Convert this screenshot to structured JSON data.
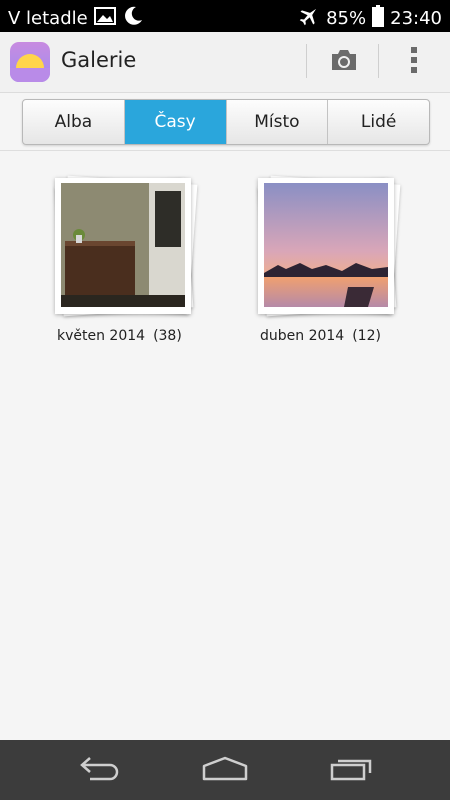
{
  "status_bar": {
    "carrier_text": "V letadle",
    "battery": "85%",
    "time": "23:40",
    "icons": [
      "image-icon",
      "moon-icon",
      "airplane-icon",
      "battery-icon"
    ]
  },
  "app": {
    "title": "Galerie",
    "icon": "gallery-app-icon",
    "actions": [
      "camera-icon",
      "overflow-menu-icon"
    ]
  },
  "tabs": [
    {
      "label": "Alba",
      "active": false
    },
    {
      "label": "Časy",
      "active": true
    },
    {
      "label": "Místo",
      "active": false
    },
    {
      "label": "Lidé",
      "active": false
    }
  ],
  "albums": [
    {
      "name": "květen 2014",
      "count": "(38)"
    },
    {
      "name": "duben 2014",
      "count": "(12)"
    }
  ],
  "nav": [
    "back-icon",
    "home-icon",
    "recent-apps-icon"
  ],
  "colors": {
    "accent": "#2aa6dc",
    "statusbar": "#000000",
    "navbar": "#3c3c3c",
    "background": "#f5f5f5"
  }
}
